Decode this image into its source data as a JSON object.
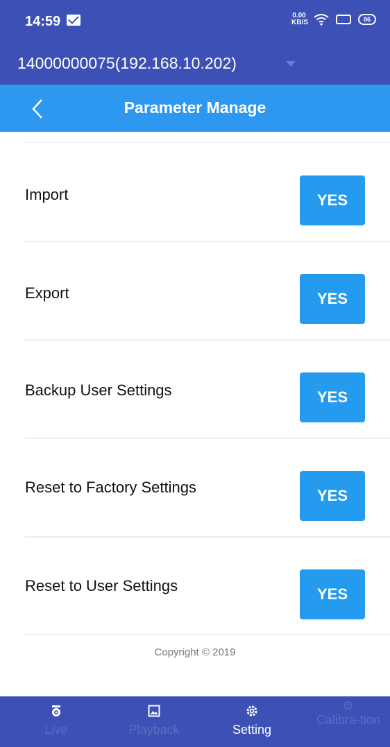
{
  "status_bar": {
    "time": "14:59",
    "net_speed": "0.00 KB/S",
    "battery": "86"
  },
  "device": {
    "selected": "14000000075(192.168.10.202)"
  },
  "header": {
    "title": "Parameter Manage"
  },
  "rows": [
    {
      "label": "Import",
      "button": "YES"
    },
    {
      "label": "Export",
      "button": "YES"
    },
    {
      "label": "Backup User Settings",
      "button": "YES"
    },
    {
      "label": "Reset to Factory Settings",
      "button": "YES"
    },
    {
      "label": "Reset to User Settings",
      "button": "YES"
    }
  ],
  "footer": {
    "copyright": "Copyright © 2019"
  },
  "tabs": [
    {
      "label": "Live",
      "icon": "camera-icon",
      "active": false
    },
    {
      "label": "Playback",
      "icon": "image-icon",
      "active": false
    },
    {
      "label": "Setting",
      "icon": "gear-icon",
      "active": true
    },
    {
      "label": "Calibra-tion",
      "icon": "calibration-icon",
      "active": false
    }
  ],
  "colors": {
    "status_bar": "#3d50b5",
    "title_bar": "#2e98f0",
    "button": "#249bef",
    "tab_inactive": "#5e6cc0"
  }
}
